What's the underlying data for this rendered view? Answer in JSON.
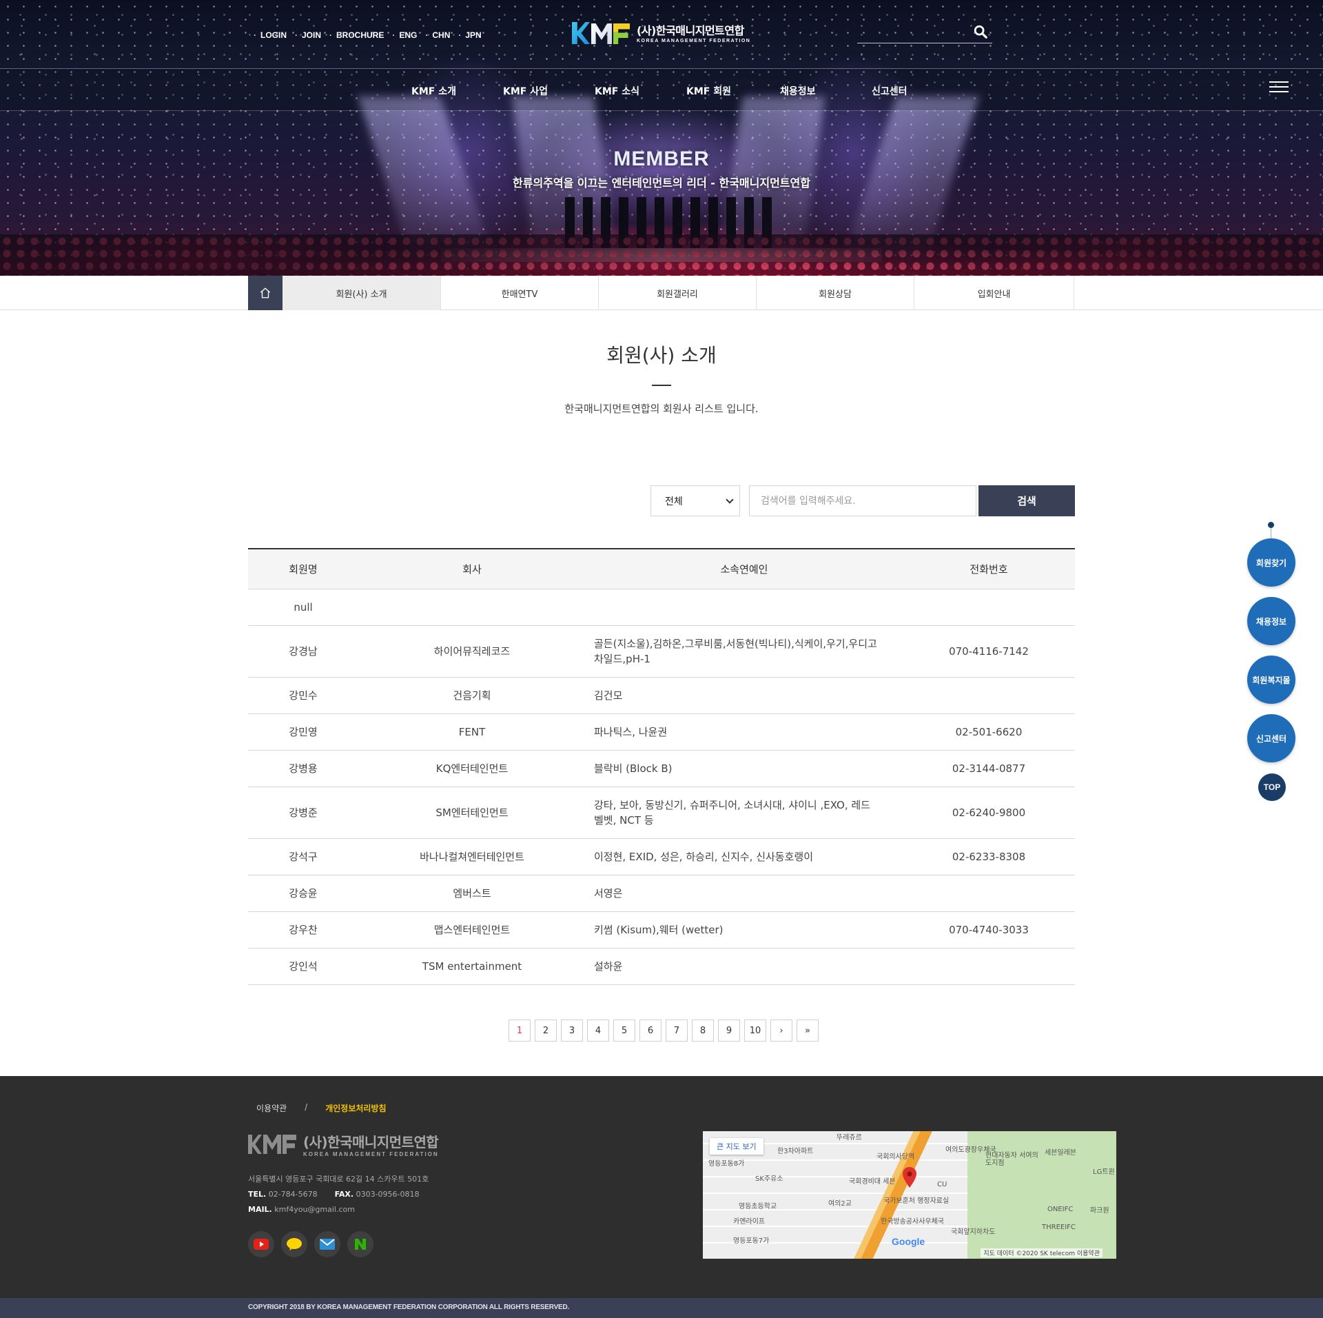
{
  "header": {
    "util_links": [
      "LOGIN",
      "JOIN",
      "BROCHURE",
      "ENG",
      "CHN",
      "JPN"
    ],
    "logo_ko": "(사)한국매니지먼트연합",
    "logo_en": "KOREA MANAGEMENT FEDERATION",
    "search_icon": "search-icon",
    "menu_icon": "hamburger-icon"
  },
  "gnb": [
    "KMF 소개",
    "KMF 사업",
    "KMF 소식",
    "KMF 회원",
    "채용정보",
    "신고센터"
  ],
  "hero": {
    "title": "MEMBER",
    "subtitle": "한류의주역을 이끄는 엔터테인먼트의 리더 - 한국매니지먼트연합"
  },
  "subnav": {
    "home_icon": "home-icon",
    "tabs": [
      "회원(사) 소개",
      "한매연TV",
      "회원갤러리",
      "회원상담",
      "입회안내"
    ],
    "active_index": 0
  },
  "page": {
    "title": "회원(사) 소개",
    "description": "한국매니지먼트연합의 회원사 리스트 입니다."
  },
  "search": {
    "select_value": "전체",
    "input_value": "",
    "placeholder": "검색어를 입력해주세요.",
    "button_label": "검색"
  },
  "table": {
    "headers": [
      "회원명",
      "회사",
      "소속연예인",
      "전화번호"
    ],
    "rows": [
      {
        "name": "null",
        "company": "",
        "artists": "",
        "phone": ""
      },
      {
        "name": "강경남",
        "company": "하이어뮤직레코즈",
        "artists": "골든(지소울),김하온,그루비룸,서동현(빅나티),식케이,우기,우디고차일드,pH-1",
        "phone": "070-4116-7142"
      },
      {
        "name": "강민수",
        "company": "건음기획",
        "artists": "김건모",
        "phone": ""
      },
      {
        "name": "강민영",
        "company": "FENT",
        "artists": "파나틱스, 나윤권",
        "phone": "02-501-6620"
      },
      {
        "name": "강병용",
        "company": "KQ엔터테인먼트",
        "artists": "블락비 (Block B)",
        "phone": "02-3144-0877"
      },
      {
        "name": "강병준",
        "company": "SM엔터테인먼트",
        "artists": "강타, 보아, 동방신기, 슈퍼주니어, 소녀시대, 샤이니 ,EXO, 레드벨벳, NCT 등",
        "phone": "02-6240-9800"
      },
      {
        "name": "강석구",
        "company": "바나나컬쳐엔터테인먼트",
        "artists": "이정현, EXID, 성은, 하승리, 신지수, 신사동호랭이",
        "phone": "02-6233-8308"
      },
      {
        "name": "강승윤",
        "company": "엠버스트",
        "artists": "서영은",
        "phone": ""
      },
      {
        "name": "강우찬",
        "company": "맵스엔터테인먼트",
        "artists": "키썸 (Kisum),웨터 (wetter)",
        "phone": "070-4740-3033"
      },
      {
        "name": "강인석",
        "company": "TSM entertainment",
        "artists": "설하윤",
        "phone": ""
      }
    ]
  },
  "pagination": {
    "pages": [
      "1",
      "2",
      "3",
      "4",
      "5",
      "6",
      "7",
      "8",
      "9",
      "10"
    ],
    "current": "1",
    "next": "›",
    "last": "»",
    "accent_color": "#e6324b"
  },
  "quick_menu": {
    "items": [
      "회원찾기",
      "채용정보",
      "회원복지몰",
      "신고센터"
    ],
    "top_label": "TOP",
    "color": "#1f6db9"
  },
  "footer": {
    "links": [
      "이용약관",
      "/",
      "개인정보처리방침"
    ],
    "logo_ko": "(사)한국매니지먼트연합",
    "logo_en": "KOREA MANAGEMENT FEDERATION",
    "address": "서울특별시 영등포구 국회대로 62길 14 스카우트 501호",
    "tel_label": "TEL.",
    "tel": "02-784-5678",
    "fax_label": "FAX.",
    "fax": "0303-0956-0818",
    "mail_label": "MAIL.",
    "mail": "kmf4you@gmail.com",
    "sns_icons": [
      "youtube-icon",
      "kakao-icon",
      "mail-icon",
      "naver-icon"
    ],
    "map": {
      "big_map_label": "큰 지도 보기",
      "labels": [
        "국회의사당역",
        "여의도광장우체국",
        "현대자동차 서여의도지점",
        "세븐일레븐",
        "국회경비대 세븐",
        "국가보훈처 행정자료실",
        "한국방송공사사우체국",
        "국회앞지하차도",
        "영등포동8가",
        "SK주유소",
        "영등초등학교",
        "카엔라이프",
        "영등포동7가",
        "여의2교",
        "ONEIFC",
        "THREEIFC",
        "파크원",
        "LG트윈",
        "뚜레쥬르",
        "한3차아파트",
        "CU"
      ],
      "google": "Google",
      "attribution": "지도 데이터 ©2020 SK telecom   이용약관"
    },
    "copyright": "COPYRIGHT 2018 BY KOREA MANAGEMENT FEDERATION CORPORATION ALL RIGHTS RESERVED."
  }
}
